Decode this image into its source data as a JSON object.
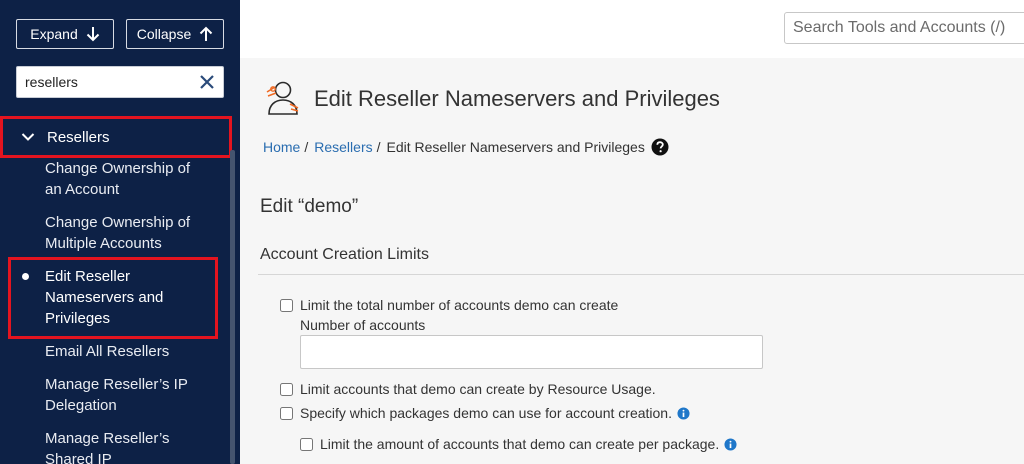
{
  "sidebar": {
    "expand_label": "Expand",
    "collapse_label": "Collapse",
    "filter_value": "resellers",
    "category_label": "Resellers",
    "items": [
      {
        "line1": "Change Ownership of",
        "line2": "an Account"
      },
      {
        "line1": "Change Ownership of",
        "line2": "Multiple Accounts"
      },
      {
        "line1": "Edit Reseller",
        "line2": "Nameservers and",
        "line3": "Privileges"
      },
      {
        "line1": "Email All Resellers"
      },
      {
        "line1": "Manage Reseller’s IP",
        "line2": "Delegation"
      },
      {
        "line1": "Manage Reseller’s",
        "line2": "Shared IP"
      }
    ]
  },
  "header": {
    "search_placeholder": "Search Tools and Accounts (/)"
  },
  "main": {
    "page_title": "Edit Reseller Nameservers and Privileges",
    "breadcrumb": {
      "home": "Home",
      "sep": "/",
      "resellers": "Resellers",
      "current": "Edit Reseller Nameservers and Privileges"
    },
    "edit_heading": "Edit “demo”",
    "section_heading": "Account Creation Limits",
    "options": {
      "limit_total": "Limit the total number of accounts demo can create",
      "number_label": "Number of accounts",
      "limit_resource": "Limit accounts that demo can create by Resource Usage.",
      "specify_packages": "Specify which packages demo can use for account creation.",
      "limit_per_package": "Limit the amount of accounts that demo can create per package."
    }
  },
  "colors": {
    "sidebar_bg": "#0d2146",
    "highlight_red": "#e3141f",
    "link_blue": "#2a6db0",
    "info_blue": "#1f77c9"
  }
}
